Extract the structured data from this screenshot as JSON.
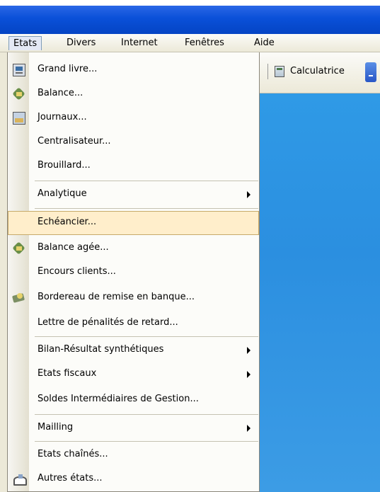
{
  "menubar": {
    "items": [
      {
        "label": "Etats"
      },
      {
        "label": "Divers"
      },
      {
        "label": "Internet"
      },
      {
        "label": "Fenêtres"
      },
      {
        "label": "Aide"
      }
    ]
  },
  "toolbar": {
    "calc_label": "Calculatrice"
  },
  "dropdown": {
    "items": [
      {
        "label": "Grand livre..."
      },
      {
        "label": "Balance..."
      },
      {
        "label": "Journaux..."
      },
      {
        "label": "Centralisateur..."
      },
      {
        "label": "Brouillard..."
      },
      {
        "label": "Analytique"
      },
      {
        "label": "Echéancier..."
      },
      {
        "label": "Balance agée..."
      },
      {
        "label": "Encours clients..."
      },
      {
        "label": "Bordereau de remise en banque..."
      },
      {
        "label": "Lettre de pénalités de retard..."
      },
      {
        "label": "Bilan-Résultat synthétiques"
      },
      {
        "label": "Etats fiscaux"
      },
      {
        "label": "Soldes Intermédiaires de Gestion..."
      },
      {
        "label": "Mailling"
      },
      {
        "label": "Etats chaînés..."
      },
      {
        "label": "Autres états..."
      }
    ]
  }
}
